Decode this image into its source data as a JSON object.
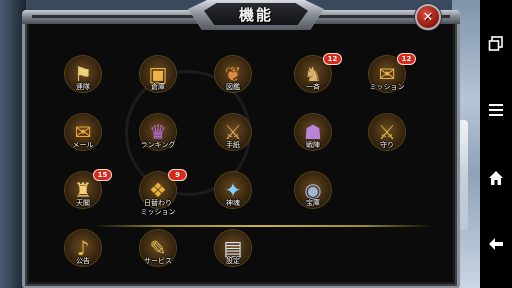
{
  "window": {
    "title": "機能",
    "close_icon": "close-x-icon"
  },
  "colors": {
    "panel_bg": "#0b0b0b",
    "frame": "#8a8f98",
    "badge": "#d72a1e",
    "divider": "#c8b640",
    "close": "#c1372a"
  },
  "items": [
    {
      "label": "連隊",
      "icon": "regiment-flag-icon",
      "glyph": "⚑",
      "badge": ""
    },
    {
      "label": "倉庫",
      "icon": "treasure-chest-icon",
      "glyph": "▣",
      "badge": ""
    },
    {
      "label": "図鑑",
      "icon": "dragon-book-icon",
      "glyph": "❦",
      "badge": ""
    },
    {
      "label": "一斉",
      "icon": "warrior-icon",
      "glyph": "♞",
      "badge": "12"
    },
    {
      "label": "ミッション",
      "icon": "mission-scroll-icon",
      "glyph": "✉",
      "badge": "12"
    },
    {
      "label": "メール",
      "icon": "mail-icon",
      "glyph": "✉",
      "badge": ""
    },
    {
      "label": "ランキング",
      "icon": "ranking-banner-icon",
      "glyph": "♛",
      "badge": ""
    },
    {
      "label": "手紙",
      "icon": "letter-knight-icon",
      "glyph": "⚔",
      "badge": ""
    },
    {
      "label": "戦陣",
      "icon": "battle-formation-icon",
      "glyph": "☗",
      "badge": ""
    },
    {
      "label": "守り",
      "icon": "crossed-swords-icon",
      "glyph": "⚔",
      "badge": ""
    },
    {
      "label": "天閣",
      "icon": "tower-icon",
      "glyph": "♜",
      "badge": "15"
    },
    {
      "label": "日替わり\nミッション",
      "icon": "daily-mission-chest-icon",
      "glyph": "❖",
      "badge": "9"
    },
    {
      "label": "神魂",
      "icon": "crystal-icon",
      "glyph": "✦",
      "badge": ""
    },
    {
      "label": "宝庫",
      "icon": "vault-clock-icon",
      "glyph": "◉",
      "badge": ""
    },
    {
      "label": "公告",
      "icon": "horn-icon",
      "glyph": "♪",
      "badge": ""
    },
    {
      "label": "サービス",
      "icon": "service-scroll-icon",
      "glyph": "✎",
      "badge": ""
    },
    {
      "label": "設定",
      "icon": "settings-book-icon",
      "glyph": "▤",
      "badge": ""
    }
  ],
  "navbar": {
    "recents_icon": "recent-apps-icon",
    "menu_icon": "menu-icon",
    "home_icon": "home-icon",
    "back_icon": "back-arrow-icon"
  }
}
